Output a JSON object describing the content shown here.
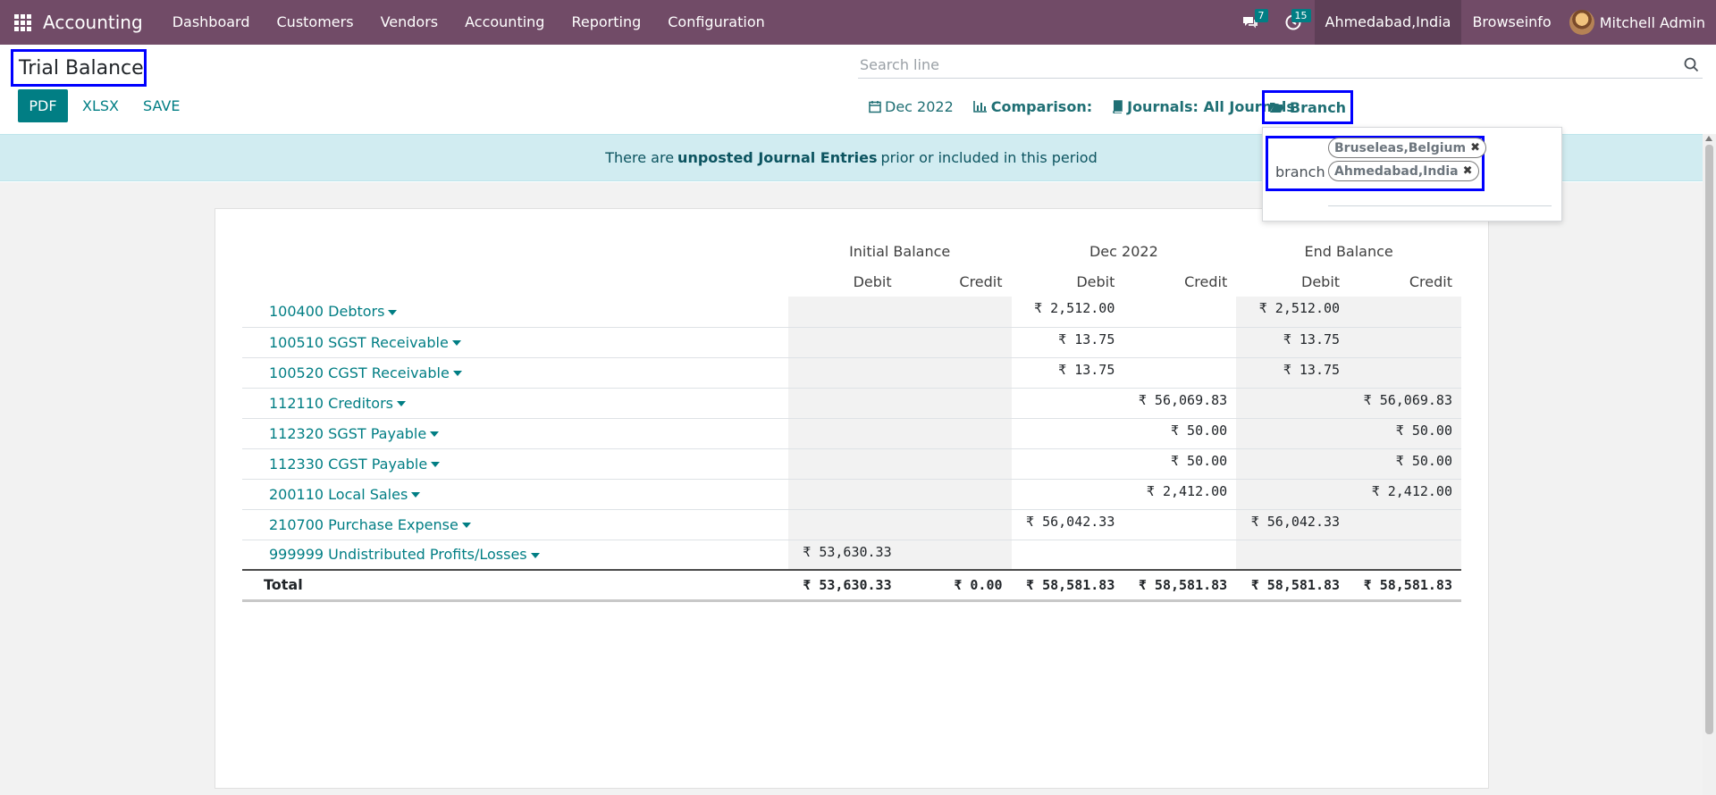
{
  "navbar": {
    "app_name": "Accounting",
    "menu": [
      "Dashboard",
      "Customers",
      "Vendors",
      "Accounting",
      "Reporting",
      "Configuration"
    ],
    "messages_count": "7",
    "activities_count": "15",
    "company": "Ahmedabad,India",
    "company2": "Browseinfo",
    "user": "Mitchell Admin",
    "bar_color": "#714b67"
  },
  "control": {
    "title": "Trial Balance",
    "search_placeholder": "Search line",
    "buttons": {
      "pdf": "PDF",
      "xlsx": "XLSX",
      "save": "SAVE"
    },
    "filters": {
      "date": "Dec 2022",
      "comparison": "Comparison:",
      "journals": "Journals: All Journals",
      "branch": "Branch"
    }
  },
  "notice": {
    "before": "There are",
    "bold": "unposted Journal Entries",
    "after": "prior or included in this period"
  },
  "branch_dropdown": {
    "label": "branch",
    "tags": [
      "Bruseleas,Belgium",
      "Ahmedabad,India"
    ],
    "remove_glyph": "✖"
  },
  "report": {
    "groups": [
      "Initial Balance",
      "Dec 2022",
      "End Balance"
    ],
    "sub": [
      "Debit",
      "Credit",
      "Debit",
      "Credit",
      "Debit",
      "Credit"
    ],
    "rows": [
      {
        "account": "100400 Debtors",
        "v": [
          "",
          "",
          "₹ 2,512.00",
          "",
          "₹ 2,512.00",
          ""
        ]
      },
      {
        "account": "100510 SGST Receivable",
        "v": [
          "",
          "",
          "₹ 13.75",
          "",
          "₹ 13.75",
          ""
        ]
      },
      {
        "account": "100520 CGST Receivable",
        "v": [
          "",
          "",
          "₹ 13.75",
          "",
          "₹ 13.75",
          ""
        ]
      },
      {
        "account": "112110 Creditors",
        "v": [
          "",
          "",
          "",
          "₹ 56,069.83",
          "",
          "₹ 56,069.83"
        ]
      },
      {
        "account": "112320 SGST Payable",
        "v": [
          "",
          "",
          "",
          "₹ 50.00",
          "",
          "₹ 50.00"
        ]
      },
      {
        "account": "112330 CGST Payable",
        "v": [
          "",
          "",
          "",
          "₹ 50.00",
          "",
          "₹ 50.00"
        ]
      },
      {
        "account": "200110 Local Sales",
        "v": [
          "",
          "",
          "",
          "₹ 2,412.00",
          "",
          "₹ 2,412.00"
        ]
      },
      {
        "account": "210700 Purchase Expense",
        "v": [
          "",
          "",
          "₹ 56,042.33",
          "",
          "₹ 56,042.33",
          ""
        ]
      },
      {
        "account": "999999 Undistributed Profits/Losses",
        "v": [
          "₹ 53,630.33",
          "",
          "",
          "",
          "",
          ""
        ]
      }
    ],
    "total": {
      "label": "Total",
      "v": [
        "₹ 53,630.33",
        "₹ 0.00",
        "₹ 58,581.83",
        "₹ 58,581.83",
        "₹ 58,581.83",
        "₹ 58,581.83"
      ]
    }
  }
}
